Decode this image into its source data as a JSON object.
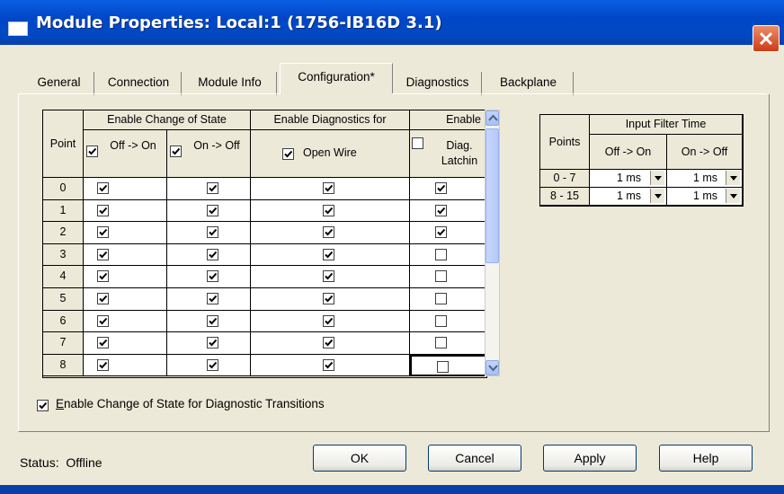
{
  "window": {
    "title": "Module Properties: Local:1 (1756-IB16D 3.1)"
  },
  "tabs": [
    {
      "label": "General"
    },
    {
      "label": "Connection"
    },
    {
      "label": "Module Info"
    },
    {
      "label": "Configuration*"
    },
    {
      "label": "Diagnostics"
    },
    {
      "label": "Backplane"
    }
  ],
  "active_tab": "Configuration*",
  "point_table": {
    "headers": {
      "point": "Point",
      "cos_group": "Enable Change of State",
      "diag_group": "Enable Diagnostics for",
      "latch_group": "Enable",
      "off_on": "Off -> On",
      "on_off": "On -> Off",
      "open_wire": "Open Wire",
      "diag_latch": "Diag. Latchin"
    },
    "header_checks": {
      "off_on": true,
      "on_off": true,
      "open_wire": true,
      "diag_latch": false
    },
    "rows": [
      {
        "point": "0",
        "off_on": true,
        "on_off": true,
        "open_wire": true,
        "latch": true
      },
      {
        "point": "1",
        "off_on": true,
        "on_off": true,
        "open_wire": true,
        "latch": true
      },
      {
        "point": "2",
        "off_on": true,
        "on_off": true,
        "open_wire": true,
        "latch": true
      },
      {
        "point": "3",
        "off_on": true,
        "on_off": true,
        "open_wire": true,
        "latch": false
      },
      {
        "point": "4",
        "off_on": true,
        "on_off": true,
        "open_wire": true,
        "latch": false
      },
      {
        "point": "5",
        "off_on": true,
        "on_off": true,
        "open_wire": true,
        "latch": false
      },
      {
        "point": "6",
        "off_on": true,
        "on_off": true,
        "open_wire": true,
        "latch": false
      },
      {
        "point": "7",
        "off_on": true,
        "on_off": true,
        "open_wire": true,
        "latch": false
      },
      {
        "point": "8",
        "off_on": true,
        "on_off": true,
        "open_wire": true,
        "latch": false
      }
    ]
  },
  "filter_table": {
    "headers": {
      "points": "Points",
      "group": "Input Filter Time",
      "off_on": "Off -> On",
      "on_off": "On -> Off"
    },
    "rows": [
      {
        "points": "0 - 7",
        "off_on": "1 ms",
        "on_off": "1 ms"
      },
      {
        "points": "8 - 15",
        "off_on": "1 ms",
        "on_off": "1 ms"
      }
    ]
  },
  "cos_diag_checkbox": {
    "label": "Enable Change of State for Diagnostic Transitions",
    "accel": "E",
    "rest": "nable Change of State for Diagnostic Transitions",
    "checked": true
  },
  "status": {
    "label": "Status:",
    "value": "Offline"
  },
  "buttons": {
    "ok": "OK",
    "cancel": "Cancel",
    "apply": "Apply",
    "help": "Help"
  },
  "colors": {
    "title_bar": "#0148c2",
    "dialog_bg": "#ece9d8",
    "close_button": "#cf3b12"
  }
}
